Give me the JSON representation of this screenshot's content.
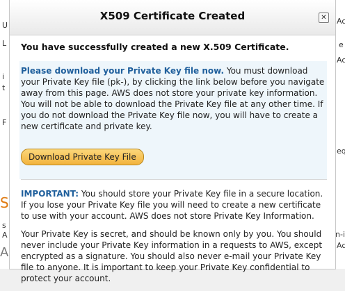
{
  "dialog": {
    "title": "X509 Certificate Created",
    "close_icon": "close-icon"
  },
  "content": {
    "success": "You have successfully created a new X.509 Certificate.",
    "download_heading": "Please download your Private Key file now.",
    "download_text": " You must download your Private Key file (pk-), by clicking the link below before you navigate away from this page. AWS does not store your private key information. You will not be able to download the Private Key file at any other time. If you do not download the Private Key file now, you will have to create a new certificate and private key.",
    "download_button": "Download Private Key File",
    "important_label": "IMPORTANT:",
    "important_text": " You should store your Private Key file in a secure location. If you lose your Private Key file you will need to create a new certificate to use with your account. AWS does not store Private Key Information.",
    "secret_text": "Your Private Key is secret, and should be known only by you. You should never include your Private Key information in a requests to AWS, except encrypted as a signature. You should also never e-mail your Private Key file to anyone. It is important to keep your Private Key confidential to protect your account."
  },
  "background": {
    "left_fragments": [
      "U",
      "L",
      "i",
      "t",
      "F",
      "S",
      "s",
      "A",
      "A"
    ],
    "right_fragments": [
      "Acc",
      "e",
      "Acco",
      "eq",
      "n-i",
      "Ac"
    ]
  },
  "colors": {
    "accent_blue": "#1f5f9c",
    "button_orange": "#f2b33d",
    "background_orange": "#e07a10"
  }
}
